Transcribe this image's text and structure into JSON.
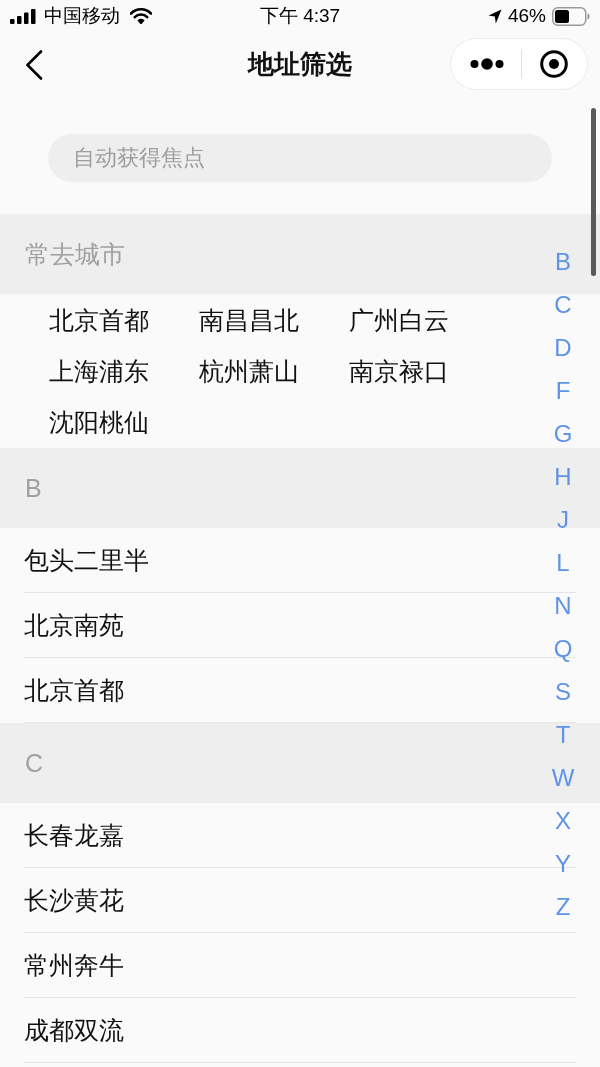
{
  "status_bar": {
    "carrier": "中国移动",
    "time": "下午 4:37",
    "battery": "46%"
  },
  "nav_bar": {
    "title": "地址筛选"
  },
  "search": {
    "placeholder": "自动获得焦点"
  },
  "frequent": {
    "title": "常去城市",
    "cities": [
      "北京首都",
      "南昌昌北",
      "广州白云",
      "上海浦东",
      "杭州萧山",
      "南京禄口",
      "沈阳桃仙"
    ]
  },
  "sections": [
    {
      "letter": "B",
      "items": [
        "包头二里半",
        "北京南苑",
        "北京首都"
      ]
    },
    {
      "letter": "C",
      "items": [
        "长春龙嘉",
        "长沙黄花",
        "常州奔牛",
        "成都双流"
      ]
    }
  ],
  "index": [
    "B",
    "C",
    "D",
    "F",
    "G",
    "H",
    "J",
    "L",
    "N",
    "Q",
    "S",
    "T",
    "W",
    "X",
    "Y",
    "Z"
  ]
}
